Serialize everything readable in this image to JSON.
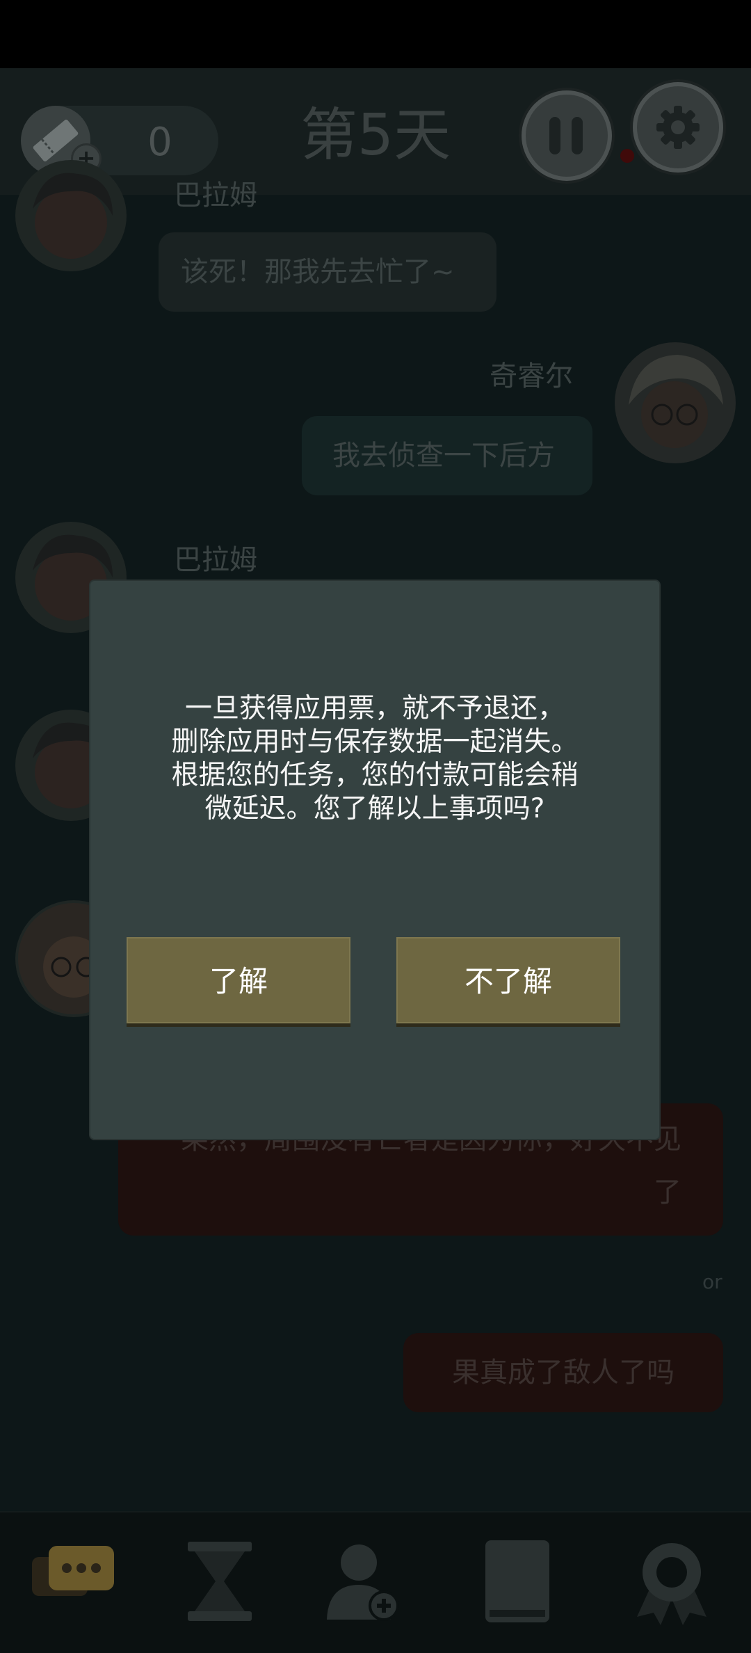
{
  "status_bar": {},
  "header": {
    "ticket_count": "0",
    "day_title": "第5天",
    "pause_icon": "pause-icon",
    "settings_icon": "gear-icon",
    "ticket_icon": "ticket-icon"
  },
  "chat": {
    "messages": [
      {
        "sender": "巴拉姆",
        "text": "该死！那我先去忙了~"
      },
      {
        "sender": "奇睿尔",
        "text": "我去侦查一下后方"
      },
      {
        "sender": "巴拉姆"
      }
    ],
    "choices": [
      {
        "text": "果然，周围没有亡者是因为你，好久不见了"
      },
      {
        "text": "果真成了敌人了吗"
      }
    ],
    "or_label": "or"
  },
  "dialog": {
    "message_lines": [
      "一旦获得应用票，就不予退还，",
      "删除应用时与保存数据一起消失。",
      "根据您的任务，您的付款可能会稍",
      "微延迟。您了解以上事项吗?"
    ],
    "confirm_label": "了解",
    "cancel_label": "不了解"
  },
  "bottom_nav": {
    "items": [
      "chat-icon",
      "hourglass-icon",
      "add-friend-icon",
      "book-icon",
      "achievement-icon"
    ]
  },
  "colors": {
    "dialog_bg": "#354241",
    "button_bg": "#6e6741",
    "overlay_dim": "#0d1718",
    "accent_nav": "#6b5a2a"
  }
}
